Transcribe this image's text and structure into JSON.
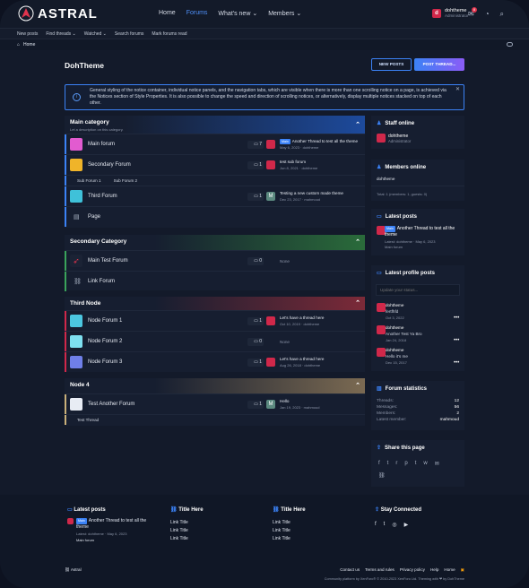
{
  "brand": {
    "name": "ASTRAL"
  },
  "nav": [
    "Home",
    "Forums",
    "What's new",
    "Members"
  ],
  "user": {
    "name": "dohtheme",
    "role": "Administrator",
    "initial": "d",
    "alerts": "8"
  },
  "subnav": [
    "New posts",
    "Find threads",
    "Watched",
    "Search forums",
    "Mark forums read"
  ],
  "breadcrumb": "Home",
  "page": {
    "title": "DohTheme",
    "new_posts": "NEW POSTS",
    "post_thread": "POST THREAD..."
  },
  "notice": "General styling of the notice container, individual notice panels, and the navigation tabs, which are visible when there is more than one scrolling notice on a page, is achieved via the Notices section of Style Properties. It is also possible to change the speed and direction of scrolling notices, or alternatively, display multiple notices stacked on top of each other.",
  "cat1": {
    "title": "Main category",
    "desc": "Let a description on this category.",
    "main": {
      "name": "Main forum",
      "count": "7",
      "prefix": "Main",
      "thread": "Another Thread to test all the theme",
      "meta": "May 6, 2023 · dohtheme"
    },
    "second": {
      "name": "Secondary Forum",
      "count": "1",
      "thread": "test sub forum",
      "meta": "Jun 8, 2021 · dohtheme"
    },
    "subforums": [
      "Sub Forum 1",
      "Sub Forum 2"
    ],
    "third": {
      "name": "Third Forum",
      "count": "1",
      "initial": "M",
      "thread": "Testing a new custom made theme",
      "meta": "Dec 23, 2017 · mahmoud"
    },
    "page": "Page"
  },
  "cat2": {
    "title": "Secondary Category",
    "main": {
      "name": "Main Test Forum",
      "count": "0",
      "none": "None"
    },
    "link": "Link Forum"
  },
  "cat3": {
    "title": "Third Node",
    "n1": {
      "name": "Node Forum 1",
      "count": "1",
      "thread": "Let's have a thread here",
      "meta": "Oct 10, 2019 · dohtheme"
    },
    "n2": {
      "name": "Node Forum 2",
      "count": "0",
      "none": "None"
    },
    "n3": {
      "name": "Node Forum 3",
      "count": "1",
      "thread": "Let's have a thread here",
      "meta": "Aug 26, 2018 · dohtheme"
    }
  },
  "cat4": {
    "title": "Node 4",
    "f": {
      "name": "Test Another Forum",
      "count": "1",
      "initial": "M",
      "thread": "Hello",
      "meta": "Jan 19, 2023 · mahmoud"
    },
    "sub": "Test Thread"
  },
  "sidebar": {
    "staff": {
      "title": "Staff online",
      "name": "dohtheme",
      "role": "Administrator"
    },
    "members": {
      "title": "Members online",
      "name": "dohtheme",
      "total": "Total: 1 (members: 1, guests: 0)"
    },
    "latest": {
      "title": "Latest posts",
      "prefix": "Main",
      "thread": "Another Thread to test all the theme",
      "meta": "Latest: dohtheme · May 6, 2023",
      "forum": "Main forum"
    },
    "profile": {
      "title": "Latest profile posts",
      "placeholder": "Update your status...",
      "posts": [
        {
          "name": "dohtheme",
          "text": "fertfhfd",
          "date": "Oct 3, 2022"
        },
        {
          "name": "dohtheme",
          "text": "Another Test Ya Bro",
          "date": "Jan 24, 2018"
        },
        {
          "name": "dohtheme",
          "text": "Hello it's me",
          "date": "Dec 15, 2017"
        }
      ]
    },
    "stats": {
      "title": "Forum statistics",
      "rows": [
        {
          "k": "Threads:",
          "v": "12"
        },
        {
          "k": "Messages:",
          "v": "56"
        },
        {
          "k": "Members:",
          "v": "2"
        },
        {
          "k": "Latest member:",
          "v": "mahmoud"
        }
      ]
    },
    "share": {
      "title": "Share this page"
    }
  },
  "footer": {
    "latest": {
      "title": "Latest posts",
      "prefix": "Main",
      "thread": "Another Thread to test all the theme",
      "meta": "Latest: dohtheme · May 6, 2023",
      "forum": "Main forum"
    },
    "col2": {
      "title": "Title Here",
      "links": [
        "Link Title",
        "Link Title",
        "Link Title"
      ]
    },
    "col3": {
      "title": "Title Here",
      "links": [
        "Link Title",
        "Link Title",
        "Link Title"
      ]
    },
    "social": {
      "title": "Stay Connected"
    },
    "style": "Astral",
    "links": [
      "Contact us",
      "Terms and rules",
      "Privacy policy",
      "Help",
      "Home"
    ],
    "copyright": "Community platform by XenForo® © 2010-2023 XenForo Ltd. Theming with ❤ by DohTheme"
  }
}
